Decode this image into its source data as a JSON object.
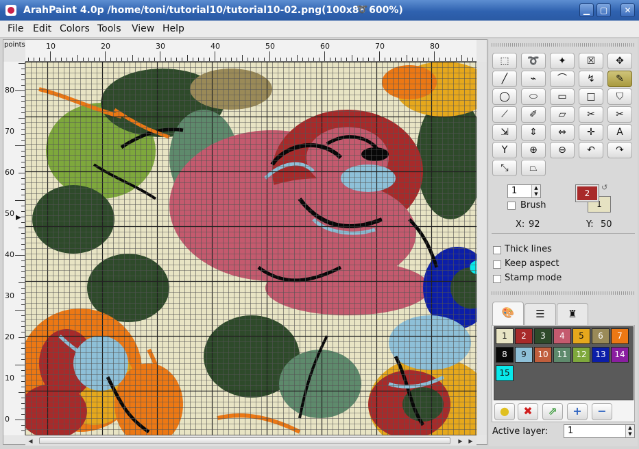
{
  "window": {
    "title": "ArahPaint 4.0p /home/toni/tutorial10/tutorial10-02.png(100x88  600%)",
    "minimize": "▁",
    "maximize": "▢",
    "close": "✕"
  },
  "menu": [
    "File",
    "Edit",
    "Colors",
    "Tools",
    "View",
    "Help"
  ],
  "ruler": {
    "unit_label": "points",
    "horizontal_ticks": [
      "10",
      "20",
      "30",
      "40",
      "50",
      "60",
      "70",
      "80"
    ],
    "vertical_ticks": [
      "80",
      "70",
      "60",
      "50",
      "40",
      "30",
      "20",
      "10",
      "0"
    ]
  },
  "tools": [
    {
      "icon": "rectangle-select-icon"
    },
    {
      "icon": "lasso-select-icon"
    },
    {
      "icon": "magic-wand-icon"
    },
    {
      "icon": "clear-selection-icon"
    },
    {
      "icon": "move-icon"
    },
    {
      "icon": "line-icon"
    },
    {
      "icon": "polyline-icon"
    },
    {
      "icon": "curve-icon"
    },
    {
      "icon": "freehand-curve-icon"
    },
    {
      "icon": "pencil-icon",
      "selected": true
    },
    {
      "icon": "circle-icon"
    },
    {
      "icon": "ellipse-icon"
    },
    {
      "icon": "rectangle-icon"
    },
    {
      "icon": "filled-rectangle-icon"
    },
    {
      "icon": "fill-bucket-icon"
    },
    {
      "icon": "color-picker-icon"
    },
    {
      "icon": "replace-color-icon"
    },
    {
      "icon": "eraser-icon"
    },
    {
      "icon": "cut-icon"
    },
    {
      "icon": "cut-color-icon"
    },
    {
      "icon": "flip-icon"
    },
    {
      "icon": "vertical-scale-icon"
    },
    {
      "icon": "horizontal-scale-icon"
    },
    {
      "icon": "center-icon"
    },
    {
      "icon": "text-icon"
    },
    {
      "icon": "reduce-colors-icon"
    },
    {
      "icon": "zoom-in-icon"
    },
    {
      "icon": "zoom-out-icon"
    },
    {
      "icon": "undo-icon"
    },
    {
      "icon": "redo-icon"
    },
    {
      "icon": "resize-icon"
    },
    {
      "icon": "perspective-icon"
    }
  ],
  "options": {
    "brush_size": "1",
    "brush_label": "Brush",
    "foreground_color_index": "2",
    "background_color_index": "1",
    "x_label": "X:",
    "x_value": "92",
    "y_label": "Y:",
    "y_value": "50",
    "thick_lines": "Thick lines",
    "keep_aspect": "Keep aspect",
    "stamp_mode": "Stamp mode"
  },
  "tabs": [
    {
      "icon": "palette-tab-icon",
      "active": true
    },
    {
      "icon": "layers-tab-icon",
      "active": false
    },
    {
      "icon": "stamp-tab-icon",
      "active": false
    }
  ],
  "palette": [
    {
      "index": "1",
      "color": "#e8e4c4"
    },
    {
      "index": "2",
      "color": "#a82a2a"
    },
    {
      "index": "3",
      "color": "#2e4a2a"
    },
    {
      "index": "4",
      "color": "#c45a6e"
    },
    {
      "index": "5",
      "color": "#e6a81c"
    },
    {
      "index": "6",
      "color": "#9a8a58"
    },
    {
      "index": "7",
      "color": "#ec7814"
    },
    {
      "index": "8",
      "color": "#080808"
    },
    {
      "index": "9",
      "color": "#8ec0d8"
    },
    {
      "index": "10",
      "color": "#c05e3c"
    },
    {
      "index": "11",
      "color": "#5e8a6c"
    },
    {
      "index": "12",
      "color": "#7ea83c"
    },
    {
      "index": "13",
      "color": "#0c1ea8"
    },
    {
      "index": "14",
      "color": "#8a1ea0"
    },
    {
      "index": "15",
      "color": "#08e8ea"
    }
  ],
  "palette_buttons": [
    {
      "icon": "lightbulb-icon"
    },
    {
      "icon": "delete-color-icon"
    },
    {
      "icon": "merge-colors-icon"
    },
    {
      "icon": "add-color-icon"
    },
    {
      "icon": "remove-color-icon"
    }
  ],
  "layer": {
    "label": "Active layer:",
    "value": "1"
  }
}
